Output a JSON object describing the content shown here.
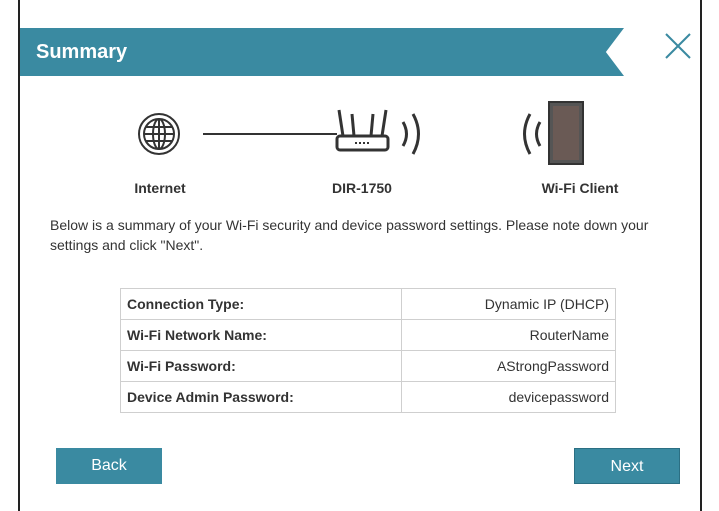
{
  "dialog": {
    "title": "Summary",
    "close_icon": "close-icon"
  },
  "diagram": {
    "internet_label": "Internet",
    "router_label": "DIR-1750",
    "client_label": "Wi-Fi Client"
  },
  "description": "Below is a summary of your Wi-Fi security and device password settings. Please note down your settings and click \"Next\".",
  "summary": {
    "rows": [
      {
        "key": "Connection Type:",
        "value": "Dynamic IP (DHCP)"
      },
      {
        "key": "Wi-Fi Network Name:",
        "value": "RouterName"
      },
      {
        "key": "Wi-Fi Password:",
        "value": "AStrongPassword"
      },
      {
        "key": "Device Admin Password:",
        "value": "devicepassword"
      }
    ]
  },
  "buttons": {
    "back_label": "Back",
    "next_label": "Next"
  },
  "colors": {
    "accent": "#3a8aa1"
  }
}
